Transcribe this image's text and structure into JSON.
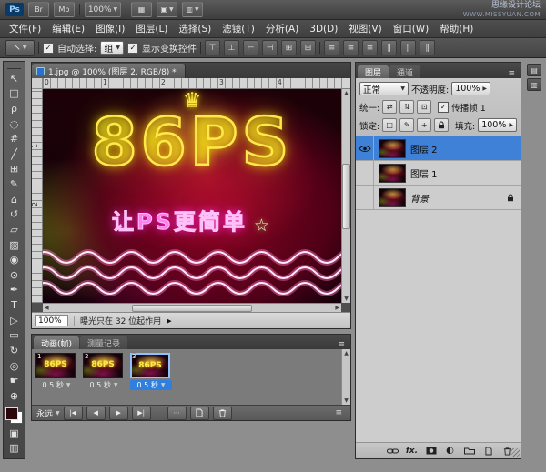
{
  "ui": {
    "check": "✓",
    "arrow_down": "▼",
    "arrow_up": "▲",
    "arrow_left": "◀",
    "arrow_right": "▶",
    "menu_grip": "≡",
    "double_left": "◀◀"
  },
  "colors": {
    "selection_blue": "#3f81d6",
    "neon_yellow": "#ffe84a",
    "neon_magenta": "#ff5bf0",
    "canvas_red": "#83041f"
  },
  "titlebar": {
    "logo": "Ps",
    "bridge_label": "Br",
    "mb_label": "Mb",
    "zoom_level": "100%",
    "view_extras_icon": "▦",
    "arrange_icon": "▣",
    "screen_mode_icon": "▥",
    "site_line1": "思缘设计论坛",
    "site_line2": "WWW.MISSYUAN.COM"
  },
  "menubar": {
    "items": [
      "文件(F)",
      "编辑(E)",
      "图像(I)",
      "图层(L)",
      "选择(S)",
      "滤镜(T)",
      "分析(A)",
      "3D(D)",
      "视图(V)",
      "窗口(W)",
      "帮助(H)"
    ]
  },
  "options_bar": {
    "tool_icon": "↖",
    "auto_select_label": "自动选择:",
    "auto_select_value": "组",
    "show_transform_label": "显示变换控件",
    "align_icons": [
      "⊤",
      "⊥",
      "⊢",
      "⊣",
      "⊞",
      "⊟"
    ],
    "distribute_icons": [
      "≡",
      "≡",
      "≡",
      "∥",
      "∥",
      "∥"
    ]
  },
  "toolbar": {
    "tools": [
      {
        "glyph": "↖"
      },
      {
        "glyph": "□"
      },
      {
        "glyph": "ρ"
      },
      {
        "glyph": "◌"
      },
      {
        "glyph": "#"
      },
      {
        "glyph": "╱"
      },
      {
        "glyph": "⊞"
      },
      {
        "glyph": "✎"
      },
      {
        "glyph": "⌂"
      },
      {
        "glyph": "↺"
      },
      {
        "glyph": "▱"
      },
      {
        "glyph": "▨"
      },
      {
        "glyph": "◉"
      },
      {
        "glyph": "⊙"
      },
      {
        "glyph": "✒"
      },
      {
        "glyph": "T"
      },
      {
        "glyph": "▷"
      },
      {
        "glyph": "▭"
      },
      {
        "glyph": "↻"
      },
      {
        "glyph": "◎"
      },
      {
        "glyph": "☛"
      },
      {
        "glyph": "⊕"
      }
    ],
    "quick_mask_icon": "▣",
    "screen_mode_icon": "▥"
  },
  "document": {
    "tab_title": "1.jpg @ 100% (图层 2, RGB/8) *",
    "zoom_value": "100%",
    "status_text": "曝光只在 32 位起作用",
    "ruler_h": [
      "0",
      "1",
      "2",
      "3",
      "4"
    ],
    "ruler_v": [
      "1",
      "2"
    ]
  },
  "artwork": {
    "crown": "♛",
    "headline": "86PS",
    "subline": "让PS更简单",
    "star": "☆"
  },
  "animation": {
    "tabs": [
      "动画(帧)",
      "测量记录"
    ],
    "loop_value": "永远",
    "transport": {
      "first": "|◀",
      "prev": "◀",
      "play": "▶",
      "next": "▶|"
    },
    "tween_icon": "⋯",
    "frames": [
      {
        "num": "1",
        "delay": "0.5 秒"
      },
      {
        "num": "2",
        "delay": "0.5 秒"
      },
      {
        "num": "3",
        "delay": "0.5 秒"
      }
    ],
    "selected_frame": 3
  },
  "layers_panel": {
    "tabs": [
      "图层",
      "通道"
    ],
    "blend_mode": "正常",
    "opacity_label": "不透明度:",
    "opacity_value": "100%",
    "unify_label": "统一:",
    "unify_icons": [
      "⇄",
      "⇅",
      "⊡"
    ],
    "propagate_label": "传播帧 1",
    "lock_label": "锁定:",
    "lock_icons": [
      "□",
      "✎",
      "+"
    ],
    "fill_label": "填充:",
    "fill_value": "100%",
    "fx_label": "fx.",
    "adjust_icon": "◐",
    "layers": [
      {
        "name": "图层 2",
        "visible": true,
        "selected": true,
        "locked": false
      },
      {
        "name": "图层 1",
        "visible": false,
        "selected": false,
        "locked": false
      },
      {
        "name": "背景",
        "visible": false,
        "selected": false,
        "locked": true
      }
    ]
  },
  "dock": {
    "collapsed_icons": [
      "▤",
      "▥"
    ]
  }
}
